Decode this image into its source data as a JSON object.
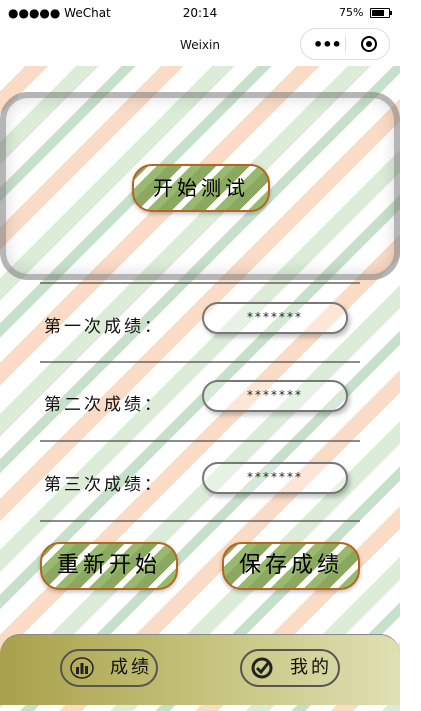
{
  "status_bar": {
    "carrier": "●●●●● WeChat",
    "time": "20:14",
    "battery": "75%"
  },
  "navbar": {
    "title": "Weixin"
  },
  "hero": {
    "start_label": "开始测试"
  },
  "scores": [
    {
      "label": "第一次成绩：",
      "value": "*******"
    },
    {
      "label": "第二次成绩：",
      "value": "*******"
    },
    {
      "label": "第三次成绩：",
      "value": "*******"
    }
  ],
  "actions": {
    "restart_label": "重新开始",
    "save_label": "保存成绩"
  },
  "tabbar": {
    "score_label": "成绩",
    "mine_label": "我的"
  },
  "colors": {
    "button_border": "#b5651d",
    "tabbar_start": "#a9a04a",
    "tabbar_end": "#dfe0b4"
  },
  "icons": {
    "score_tab": "bar-chart-icon",
    "mine_tab": "check-circle-icon"
  }
}
